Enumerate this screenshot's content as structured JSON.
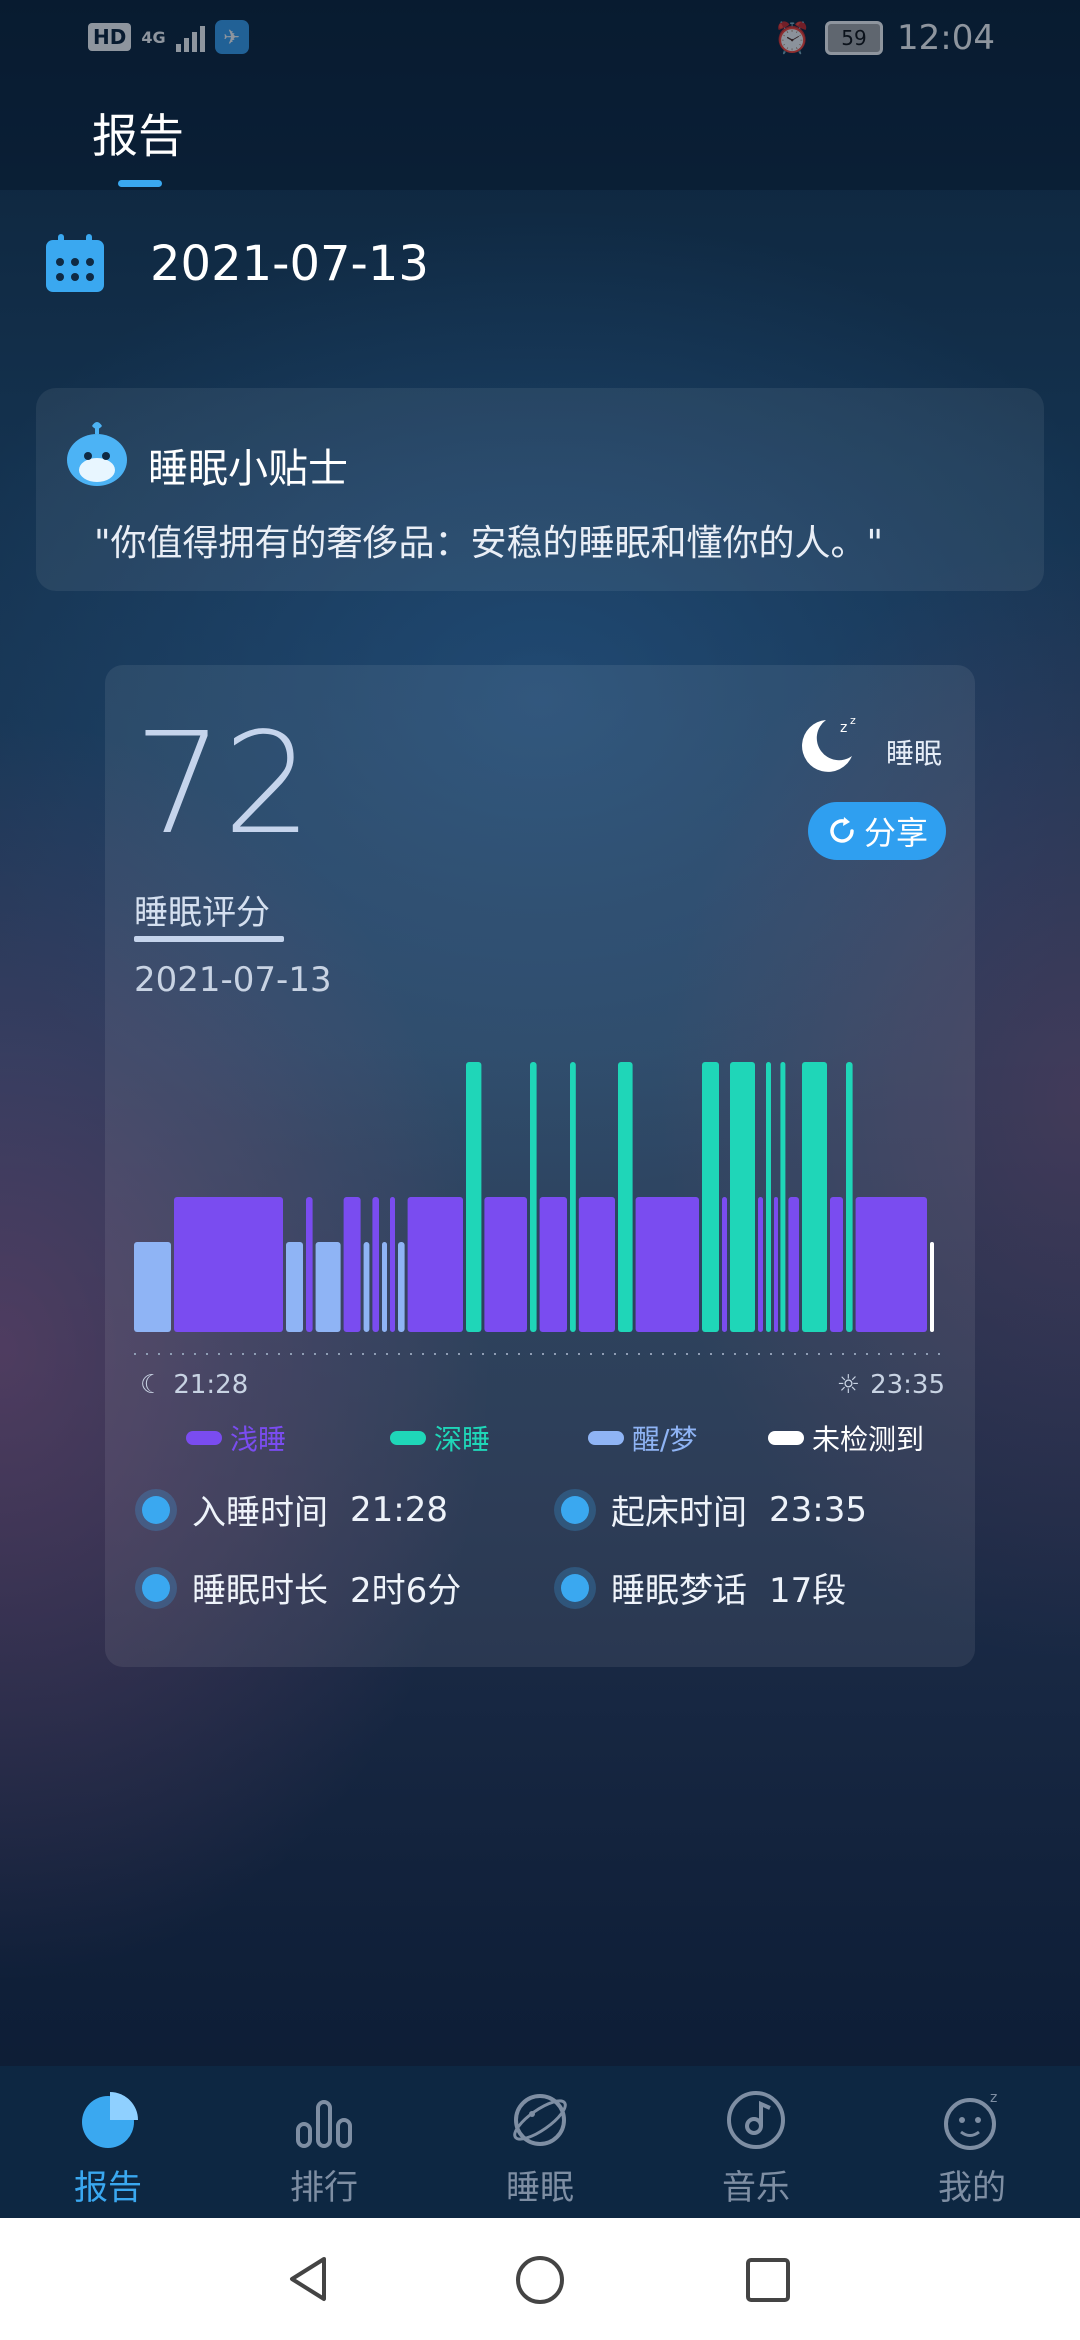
{
  "status_bar": {
    "hd": "HD",
    "network": "4G",
    "battery": "59",
    "time": "12:04"
  },
  "header": {
    "title": "报告"
  },
  "date": "2021-07-13",
  "tip": {
    "title": "睡眠小贴士",
    "text": "\"你值得拥有的奢侈品：安稳的睡眠和懂你的人。\""
  },
  "card": {
    "score": "72",
    "score_label": "睡眠评分",
    "date": "2021-07-13",
    "sleep_tag": "睡眠",
    "share_label": "分享",
    "start_time": "21:28",
    "end_time": "23:35",
    "legend": [
      {
        "label": "浅睡",
        "color": "#7a4cf0"
      },
      {
        "label": "深睡",
        "color": "#1fd6b8"
      },
      {
        "label": "醒/梦",
        "color": "#8fb4f5"
      },
      {
        "label": "未检测到",
        "color": "#ffffff"
      }
    ],
    "stats": [
      {
        "label": "入睡时间",
        "value": "21:28"
      },
      {
        "label": "起床时间",
        "value": "23:35"
      },
      {
        "label": "睡眠时长",
        "value": "2时6分"
      },
      {
        "label": "睡眠梦话",
        "value": "17段"
      }
    ]
  },
  "chart_data": {
    "type": "bar",
    "x_range": [
      "21:28",
      "23:35"
    ],
    "stage_levels": {
      "deep": 3,
      "light": 2,
      "awake": 1,
      "undetected": 0
    },
    "segments": [
      {
        "stage": "awake",
        "start": 0.0,
        "end": 0.05
      },
      {
        "stage": "light",
        "start": 0.05,
        "end": 0.19
      },
      {
        "stage": "awake",
        "start": 0.19,
        "end": 0.215
      },
      {
        "stage": "light",
        "start": 0.215,
        "end": 0.227
      },
      {
        "stage": "awake",
        "start": 0.227,
        "end": 0.262
      },
      {
        "stage": "light",
        "start": 0.262,
        "end": 0.287
      },
      {
        "stage": "awake",
        "start": 0.287,
        "end": 0.298
      },
      {
        "stage": "light",
        "start": 0.298,
        "end": 0.31
      },
      {
        "stage": "awake",
        "start": 0.31,
        "end": 0.32
      },
      {
        "stage": "light",
        "start": 0.32,
        "end": 0.33
      },
      {
        "stage": "awake",
        "start": 0.33,
        "end": 0.342
      },
      {
        "stage": "light",
        "start": 0.342,
        "end": 0.415
      },
      {
        "stage": "deep",
        "start": 0.415,
        "end": 0.438
      },
      {
        "stage": "light",
        "start": 0.438,
        "end": 0.495
      },
      {
        "stage": "deep",
        "start": 0.495,
        "end": 0.507
      },
      {
        "stage": "light",
        "start": 0.507,
        "end": 0.545
      },
      {
        "stage": "deep",
        "start": 0.545,
        "end": 0.556
      },
      {
        "stage": "light",
        "start": 0.556,
        "end": 0.605
      },
      {
        "stage": "deep",
        "start": 0.605,
        "end": 0.627
      },
      {
        "stage": "light",
        "start": 0.627,
        "end": 0.71
      },
      {
        "stage": "deep",
        "start": 0.71,
        "end": 0.735
      },
      {
        "stage": "light",
        "start": 0.735,
        "end": 0.745
      },
      {
        "stage": "deep",
        "start": 0.745,
        "end": 0.78
      },
      {
        "stage": "light",
        "start": 0.78,
        "end": 0.79
      },
      {
        "stage": "deep",
        "start": 0.79,
        "end": 0.8
      },
      {
        "stage": "light",
        "start": 0.8,
        "end": 0.808
      },
      {
        "stage": "deep",
        "start": 0.808,
        "end": 0.818
      },
      {
        "stage": "light",
        "start": 0.818,
        "end": 0.835
      },
      {
        "stage": "deep",
        "start": 0.835,
        "end": 0.87
      },
      {
        "stage": "light",
        "start": 0.87,
        "end": 0.89
      },
      {
        "stage": "deep",
        "start": 0.89,
        "end": 0.902
      },
      {
        "stage": "light",
        "start": 0.902,
        "end": 0.995
      },
      {
        "stage": "undetected",
        "start": 0.995,
        "end": 1.0
      }
    ]
  },
  "nav": {
    "items": [
      "报告",
      "排行",
      "睡眠",
      "音乐",
      "我的"
    ],
    "active": 0
  }
}
